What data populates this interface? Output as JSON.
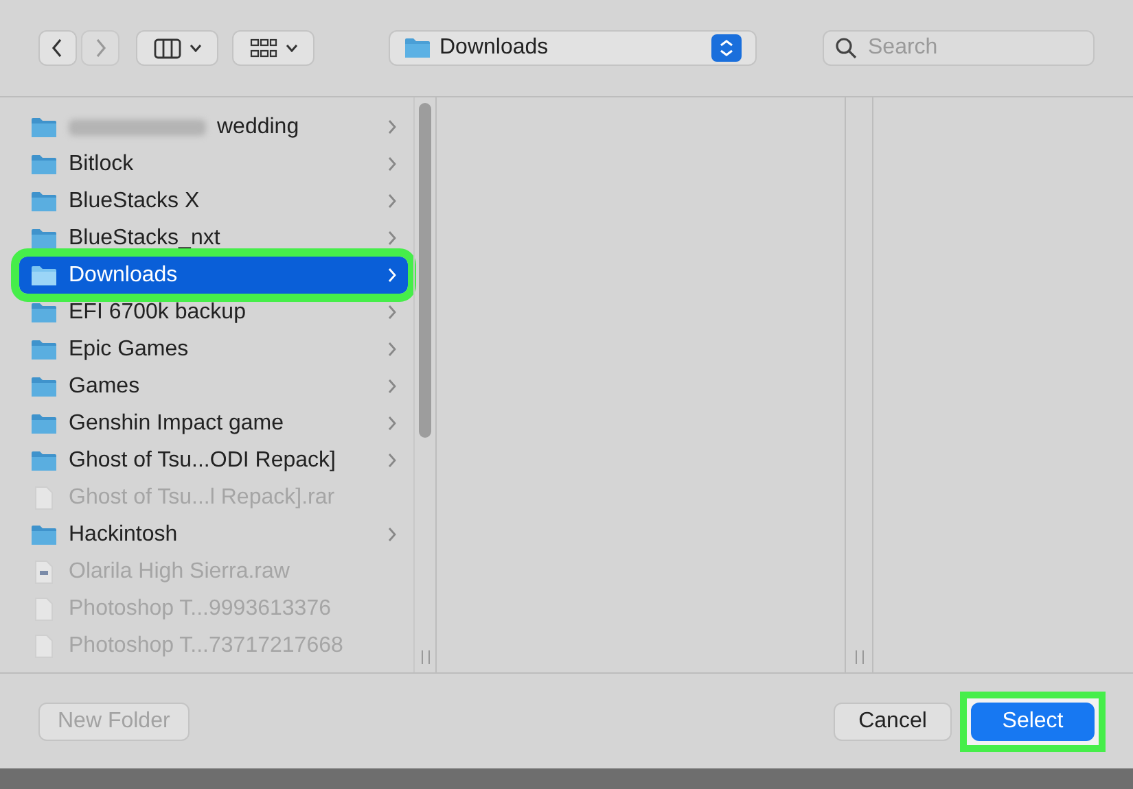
{
  "toolbar": {
    "location": "Downloads",
    "search": {
      "placeholder": "Search"
    }
  },
  "items": [
    {
      "kind": "folder",
      "label": "wedding",
      "redacted": true,
      "selected": false,
      "highlighted": false
    },
    {
      "kind": "folder",
      "label": "Bitlock",
      "selected": false,
      "highlighted": false
    },
    {
      "kind": "folder",
      "label": "BlueStacks X",
      "selected": false,
      "highlighted": false
    },
    {
      "kind": "folder",
      "label": "BlueStacks_nxt",
      "selected": false,
      "highlighted": false
    },
    {
      "kind": "folder",
      "label": "Downloads",
      "selected": true,
      "highlighted": true
    },
    {
      "kind": "folder",
      "label": "EFI 6700k backup",
      "selected": false,
      "highlighted": false
    },
    {
      "kind": "folder",
      "label": "Epic Games",
      "selected": false,
      "highlighted": false
    },
    {
      "kind": "folder",
      "label": "Games",
      "selected": false,
      "highlighted": false
    },
    {
      "kind": "folder",
      "label": "Genshin Impact game",
      "selected": false,
      "highlighted": false
    },
    {
      "kind": "folder",
      "label": "Ghost of Tsu...ODI Repack]",
      "selected": false,
      "highlighted": false
    },
    {
      "kind": "file",
      "label": "Ghost of Tsu...l Repack].rar",
      "selected": false,
      "highlighted": false
    },
    {
      "kind": "folder",
      "label": "Hackintosh",
      "selected": false,
      "highlighted": false
    },
    {
      "kind": "image",
      "label": "Olarila High Sierra.raw",
      "selected": false,
      "highlighted": false
    },
    {
      "kind": "file",
      "label": "Photoshop T...9993613376",
      "selected": false,
      "highlighted": false
    },
    {
      "kind": "file",
      "label": "Photoshop T...73717217668",
      "selected": false,
      "highlighted": false
    }
  ],
  "buttons": [
    {
      "kind": "secondary",
      "label": "New Folder",
      "disabled": true
    },
    {
      "kind": "secondary",
      "label": "Cancel",
      "disabled": false
    },
    {
      "kind": "primary",
      "label": "Select",
      "highlighted": true
    }
  ]
}
